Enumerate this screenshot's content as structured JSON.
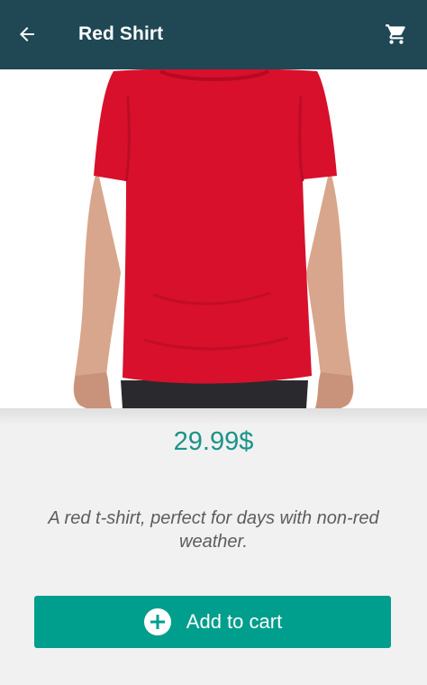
{
  "header": {
    "title": "Red Shirt",
    "back_icon": "arrow-left-icon",
    "cart_icon": "shopping-cart-icon",
    "background_color": "#1f4754"
  },
  "product": {
    "image_icon": "red-tshirt-image",
    "price": "29.99$",
    "description": "A red t-shirt, perfect for days with non-red weather.",
    "accent_color": "#009e8c"
  },
  "actions": {
    "add_to_cart_label": "Add to cart",
    "add_icon": "plus-circle-icon"
  }
}
